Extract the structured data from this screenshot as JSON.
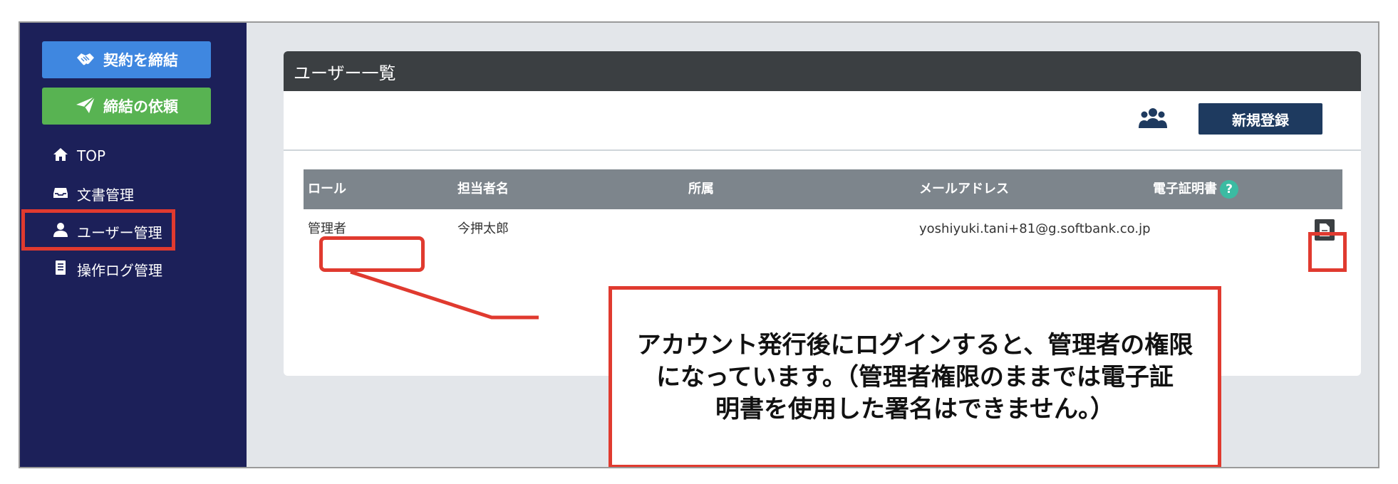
{
  "sidebar": {
    "contract_button": "契約を締結",
    "request_button": "締結の依頼",
    "items": [
      {
        "label": "TOP"
      },
      {
        "label": "文書管理"
      },
      {
        "label": "ユーザー管理"
      },
      {
        "label": "操作ログ管理"
      }
    ]
  },
  "panel": {
    "title": "ユーザー一覧",
    "new_button": "新規登録",
    "columns": [
      "ロール",
      "担当者名",
      "所属",
      "メールアドレス",
      "電子証明書"
    ],
    "help_glyph": "?",
    "rows": [
      {
        "role": "管理者",
        "name": "今押太郎",
        "affiliation": "",
        "email": "yoshiyuki.tani+81@g.softbank.co.jp"
      }
    ]
  },
  "callout": {
    "lines": [
      "アカウント発行後にログインすると、管理者の権限",
      "になっています。（管理者権限のままでは電子証",
      "明書を使用した署名はできません。）"
    ]
  },
  "colors": {
    "sidebar_bg": "#1c2059",
    "contract_button": "#3f87e0",
    "request_button": "#58b352",
    "header_bg": "#3b3f42",
    "new_button": "#1e3a5f",
    "table_header": "#7d858c",
    "highlight": "#e03a2f",
    "help_badge": "#3bbba2"
  },
  "icons": {
    "contract": "handshake-icon",
    "request": "paper-plane-icon",
    "top": "home-icon",
    "docs": "inbox-icon",
    "users": "user-icon",
    "logs": "document-list-icon",
    "group": "users-group-icon",
    "certificate": "file-icon"
  }
}
